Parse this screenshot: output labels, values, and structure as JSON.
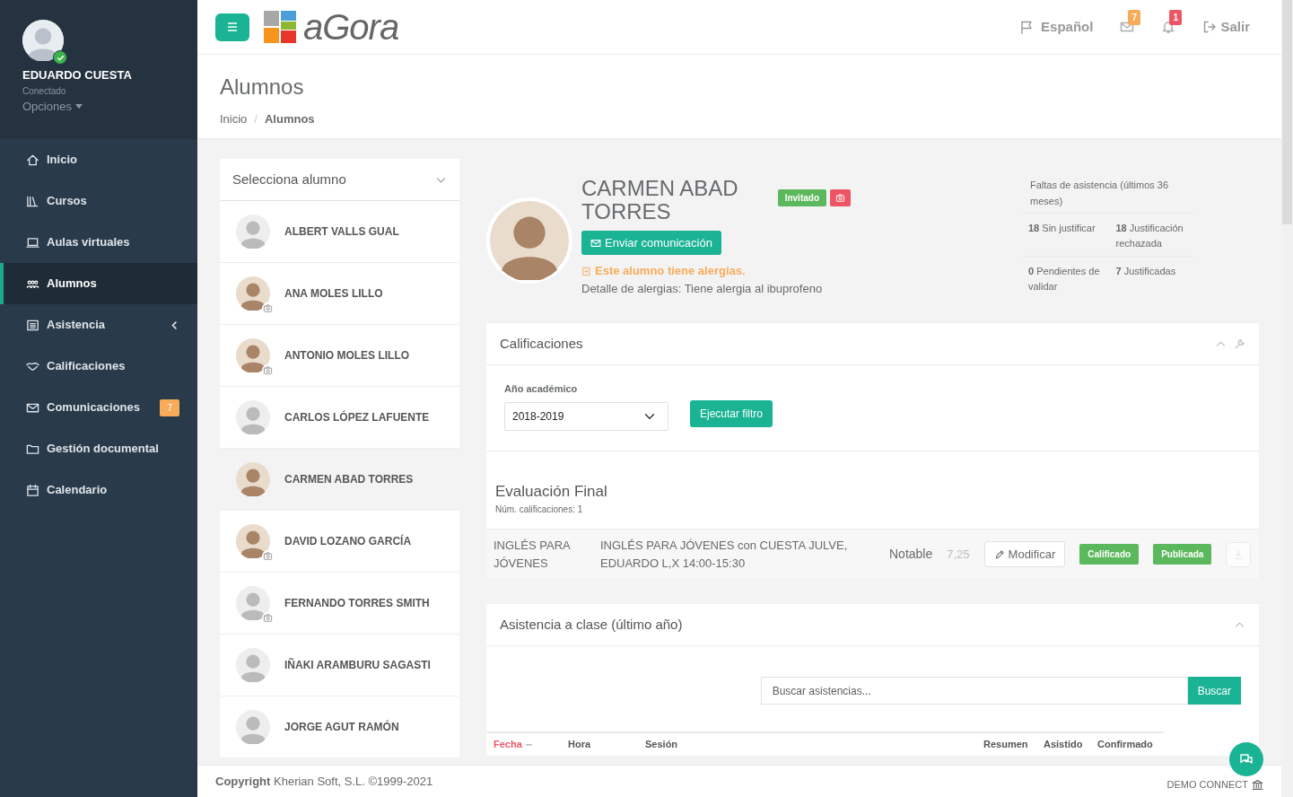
{
  "user": {
    "name": "EDUARDO CUESTA",
    "status": "Conectado",
    "options": "Opciones",
    "online": true
  },
  "nav": [
    {
      "label": "Inicio",
      "selected": false,
      "expandable": false
    },
    {
      "label": "Cursos",
      "selected": false,
      "expandable": false
    },
    {
      "label": "Aulas virtuales",
      "selected": false,
      "expandable": false
    },
    {
      "label": "Alumnos",
      "selected": true,
      "expandable": false
    },
    {
      "label": "Asistencia",
      "selected": false,
      "expandable": true
    },
    {
      "label": "Calificaciones",
      "selected": false,
      "expandable": false
    },
    {
      "label": "Comunicaciones",
      "selected": false,
      "expandable": false,
      "badge": "7"
    },
    {
      "label": "Gestión documental",
      "selected": false,
      "expandable": false
    },
    {
      "label": "Calendario",
      "selected": false,
      "expandable": false
    }
  ],
  "topbar": {
    "logo": "aGora",
    "language": "Español",
    "mail_badge": "7",
    "bell_badge": "1",
    "logout": "Salir"
  },
  "page": {
    "title": "Alumnos",
    "breadcrumb_separator": "/",
    "breadcrumb": [
      {
        "label": "Inicio",
        "selected": false
      },
      {
        "label": "Alumnos",
        "selected": true
      }
    ]
  },
  "student_select": {
    "label": "Selecciona alumno"
  },
  "students": [
    {
      "name": "ALBERT VALLS GUAL",
      "photo": false,
      "camera": false,
      "selected": false
    },
    {
      "name": "ANA MOLES LILLO",
      "photo": true,
      "camera": true,
      "selected": false
    },
    {
      "name": "ANTONIO MOLES LILLO",
      "photo": true,
      "camera": true,
      "selected": false
    },
    {
      "name": "CARLOS LÓPEZ LAFUENTE",
      "photo": false,
      "camera": false,
      "selected": false
    },
    {
      "name": "CARMEN ABAD TORRES",
      "photo": true,
      "camera": false,
      "selected": true
    },
    {
      "name": "DAVID LOZANO GARCÍA",
      "photo": true,
      "camera": true,
      "selected": false
    },
    {
      "name": "FERNANDO TORRES SMITH",
      "photo": false,
      "camera": true,
      "selected": false
    },
    {
      "name": "IÑAKI ARAMBURU SAGASTI",
      "photo": false,
      "camera": false,
      "selected": false
    },
    {
      "name": "JORGE AGUT RAMÓN",
      "photo": false,
      "camera": false,
      "selected": false
    }
  ],
  "profile": {
    "name": "CARMEN ABAD TORRES",
    "status_badge": "Invitado",
    "send_button": "Enviar comunicación",
    "allergy_warning": "Este alumno tiene alergias.",
    "allergy_detail": "Detalle de alergias: Tiene alergia al ibuprofeno"
  },
  "absences": {
    "title": "Faltas de asistencia (últimos 36 meses)",
    "stats": [
      "**18** Sin justificar",
      "**18** Justificación rechazada",
      "**0** Pendientes de validar",
      "**7** Justificadas"
    ]
  },
  "grades": {
    "title": "Calificaciones",
    "year_label": "Año académico",
    "year": "2018-2019",
    "filter_button": "Ejecutar filtro",
    "evaluation": "Evaluación Final",
    "count": "Núm. calificaciones: 1",
    "rows": [
      {
        "subject": "INGLÉS PARA JÓVENES",
        "group": "INGLÉS PARA JÓVENES con CUESTA JULVE, EDUARDO L,X 14:00-15:30",
        "grade": "Notable",
        "score": "7,25",
        "edit_button": "Modificar",
        "tags": [
          "Calificado",
          "Publicada"
        ]
      }
    ]
  },
  "attendance": {
    "title": "Asistencia a clase (último año)",
    "search_placeholder": "Buscar asistencias...",
    "search_button": "Buscar",
    "columns": [
      {
        "label": "Fecha",
        "sorted": true
      },
      {
        "label": "Hora",
        "sorted": false
      },
      {
        "label": "Sesión",
        "sorted": false
      },
      {
        "label": "Resumen",
        "sorted": false
      },
      {
        "label": "Asistido",
        "sorted": false
      },
      {
        "label": "Confirmado",
        "sorted": false
      }
    ]
  },
  "footer": {
    "copyright": "**Copyright** Kherian Soft, S.L. ©1999-2021",
    "instance": "DEMO CONNECT"
  }
}
